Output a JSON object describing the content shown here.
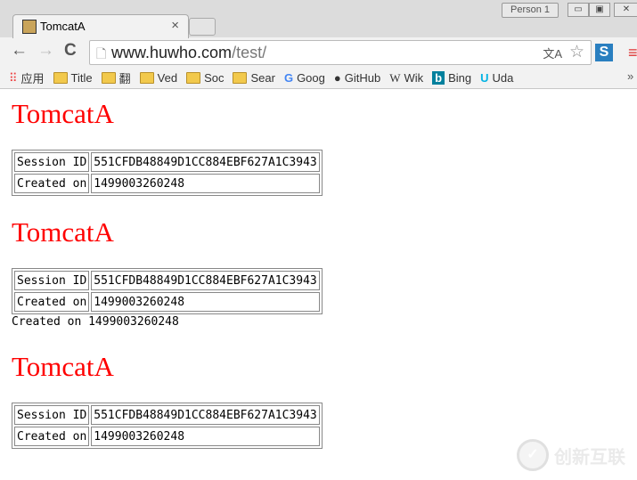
{
  "window": {
    "profile": "Person 1",
    "minimize": "▭",
    "maximize": "▣",
    "close": "✕"
  },
  "tab": {
    "title": "TomcatA",
    "close": "×"
  },
  "toolbar": {
    "back": "←",
    "forward": "→",
    "reload": "C",
    "url_host": "www.huwho.com",
    "url_path": "/test/"
  },
  "bookmarks": [
    {
      "label": "应用",
      "icon": "apps-grid-icon"
    },
    {
      "label": "Title",
      "icon": "folder-icon"
    },
    {
      "label": "翻",
      "icon": "folder-icon"
    },
    {
      "label": "Ved",
      "icon": "folder-icon"
    },
    {
      "label": "Soc",
      "icon": "folder-icon"
    },
    {
      "label": "Sear",
      "icon": "folder-icon"
    },
    {
      "label": "Goog",
      "icon": "google-icon"
    },
    {
      "label": "GitHub",
      "icon": "github-icon"
    },
    {
      "label": "Wik",
      "icon": "wikipedia-icon"
    },
    {
      "label": "Bing",
      "icon": "bing-icon"
    },
    {
      "label": "Uda",
      "icon": "udacity-icon"
    }
  ],
  "bookmarks_more": "»",
  "sections": [
    {
      "heading": "TomcatA",
      "rows": [
        [
          "Session ID",
          "551CFDB48849D1CC884EBF627A1C3943"
        ],
        [
          "Created on",
          "1499003260248"
        ]
      ]
    },
    {
      "heading": "TomcatA",
      "rows": [
        [
          "Session ID",
          "551CFDB48849D1CC884EBF627A1C3943"
        ],
        [
          "Created on",
          "1499003260248"
        ]
      ],
      "extra_text": "Created on 1499003260248"
    },
    {
      "heading": "TomcatA",
      "rows": [
        [
          "Session ID",
          "551CFDB48849D1CC884EBF627A1C3943"
        ],
        [
          "Created on",
          "1499003260248"
        ]
      ]
    }
  ],
  "watermark": "创新互联"
}
